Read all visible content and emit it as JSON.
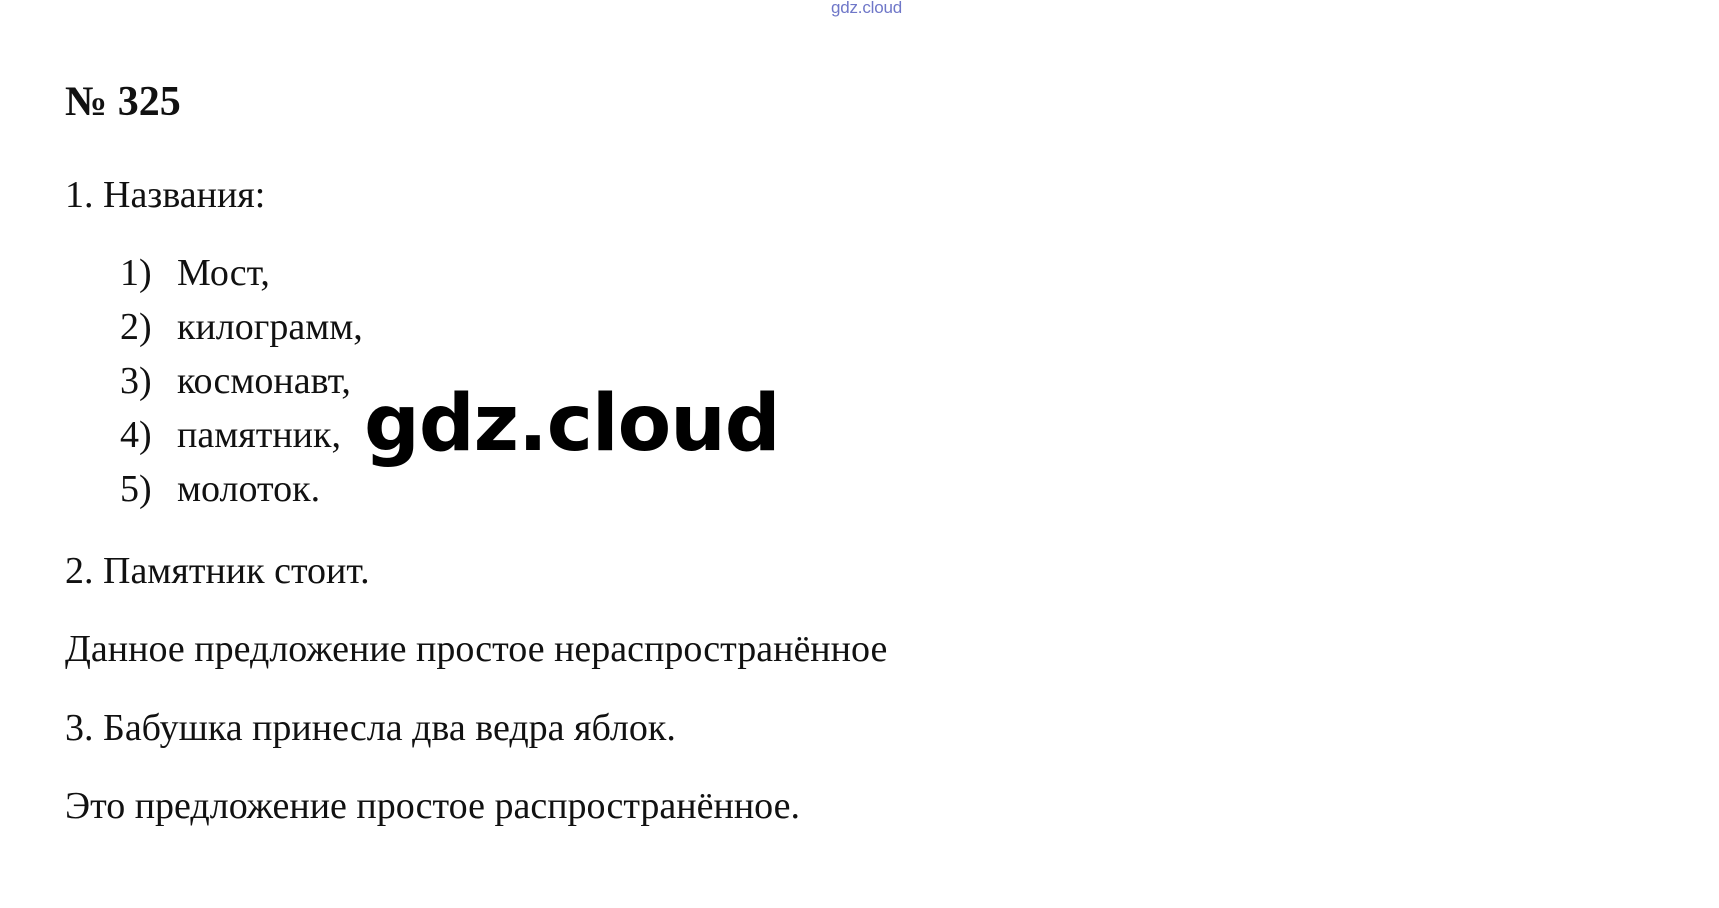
{
  "watermark_top": "gdz.cloud",
  "title": "№ 325",
  "part1": {
    "heading": "1. Названия:",
    "items": [
      {
        "num": "1)",
        "text": "Мост,"
      },
      {
        "num": "2)",
        "text": "килограмм,"
      },
      {
        "num": "3)",
        "text": "космонавт,"
      },
      {
        "num": "4)",
        "text": "памятник,"
      },
      {
        "num": "5)",
        "text": "молоток."
      }
    ]
  },
  "watermark_center": "gdz.cloud",
  "part2": {
    "sentence": "2. Памятник стоит.",
    "note": "Данное предложение простое нераспространённое"
  },
  "part3": {
    "sentence": "3. Бабушка принесла два ведра яблок.",
    "note": "Это предложение простое распространённое."
  }
}
